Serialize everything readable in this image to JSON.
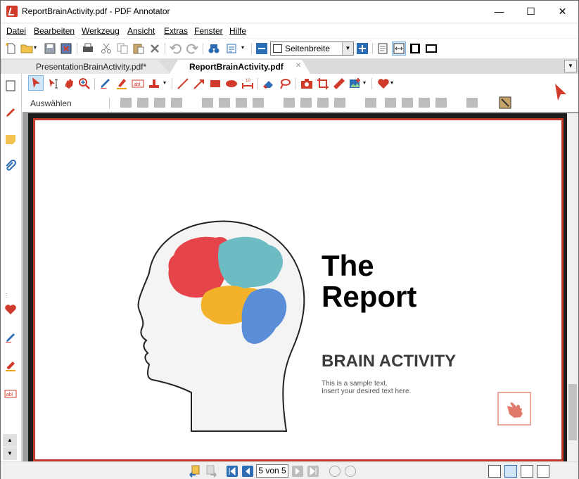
{
  "window": {
    "title": "ReportBrainActivity.pdf - PDF Annotator",
    "controls": {
      "minimize": "—",
      "maximize": "☐",
      "close": "✕"
    }
  },
  "menu": [
    "Datei",
    "Bearbeiten",
    "Werkzeug",
    "Ansicht",
    "Extras",
    "Fenster",
    "Hilfe"
  ],
  "toolbar": {
    "zoom_value": "Seitenbreite",
    "zoom_out": "−",
    "zoom_in": "+"
  },
  "tabs": [
    {
      "label": "PresentationBrainActivity.pdf*",
      "active": false
    },
    {
      "label": "ReportBrainActivity.pdf",
      "active": true
    }
  ],
  "tab_close": "✕",
  "tab_menu": "▼",
  "annotation_toolbar": {
    "current_tool_label": "Auswählen",
    "accent": "#d03a2b"
  },
  "document": {
    "heading_line1": "The",
    "heading_line2": "Report",
    "subheading": "BRAIN ACTIVITY",
    "body_line1": "This is a sample text.",
    "body_line2": "Insert your desired text here."
  },
  "statusbar": {
    "page_indicator": "5 von 5"
  },
  "sidebar": {
    "scroll_up": "▲",
    "scroll_down": "▼",
    "grip": "⋮"
  }
}
